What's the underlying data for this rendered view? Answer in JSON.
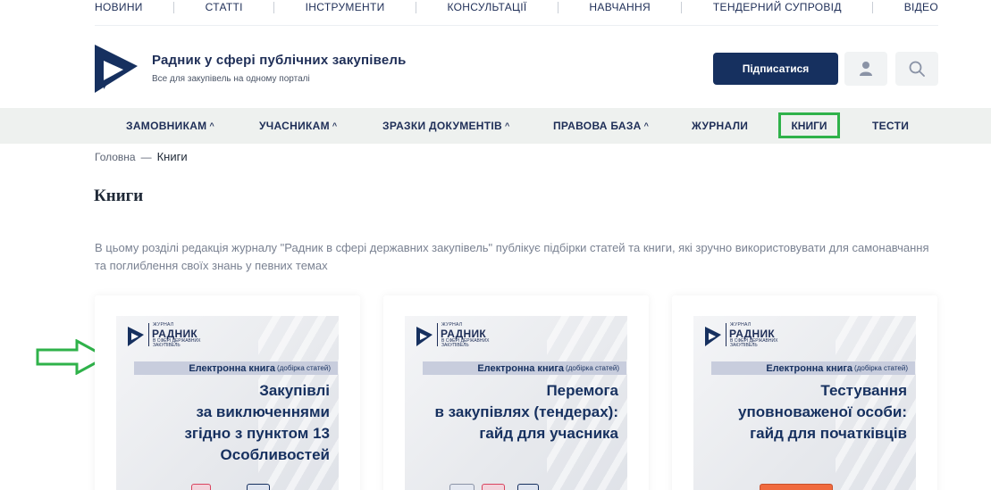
{
  "top_nav": [
    "НОВИНИ",
    "СТАТТІ",
    "ІНСТРУМЕНТИ",
    "КОНСУЛЬТАЦІЇ",
    "НАВЧАННЯ",
    "ТЕНДЕРНИЙ СУПРОВІД",
    "ВІДЕО"
  ],
  "header": {
    "brand_title": "Радник у сфері публічних закупівель",
    "brand_subtitle": "Все для закупівель на одному порталі",
    "subscribe_label": "Підписатися",
    "icons": [
      "user-icon",
      "search-icon"
    ]
  },
  "main_nav": [
    {
      "label": "ЗАМОВНИКАМ",
      "dropdown": true
    },
    {
      "label": "УЧАСНИКАМ",
      "dropdown": true
    },
    {
      "label": "ЗРАЗКИ ДОКУМЕНТІВ",
      "dropdown": true
    },
    {
      "label": "ПРАВОВА БАЗА",
      "dropdown": true
    },
    {
      "label": "ЖУРНАЛИ",
      "dropdown": false
    },
    {
      "label": "КНИГИ",
      "dropdown": false,
      "active": true
    },
    {
      "label": "ТЕСТИ",
      "dropdown": false
    }
  ],
  "caret": "^",
  "breadcrumb": {
    "home": "Головна",
    "separator": "—",
    "current": "Книги"
  },
  "page_title": "Книги",
  "intro": "В цьому розділі редакція журналу \"Радник в сфері державних закупівель\" публікує підбірки статей та книги, які зручно використовувати для самонавчання та поглиблення своїх знань у певних темах",
  "colors": {
    "brand": "#16305f",
    "highlight": "#2fb24a",
    "nav_bg": "#eef1ef"
  },
  "cover_brand": {
    "journal": "ЖУРНАЛ",
    "name": "РАДНИК",
    "tagline": "В СФЕРІ ДЕРЖАВНИХ ЗАКУПІВЕЛЬ"
  },
  "books": [
    {
      "band": "Електронна книга",
      "band_note": "(добірка статей)",
      "title_lines": [
        "Закупівлі",
        "за виключеннями",
        "згідно з пунктом 13",
        "Особливостей"
      ]
    },
    {
      "band": "Електронна книга",
      "band_note": "(добірка статей)",
      "title_lines": [
        "Перемога",
        "в закупівлях (тендерах):",
        "гайд для учасника"
      ]
    },
    {
      "band": "Електронна книга",
      "band_note": "(добірка статей)",
      "title_lines": [
        "Тестування",
        "уповноваженої особи:",
        "гайд для початківців"
      ]
    }
  ]
}
